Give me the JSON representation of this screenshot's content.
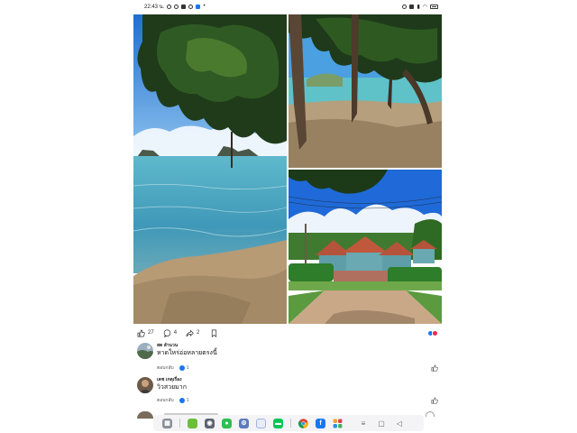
{
  "status_bar": {
    "time": "22:43 น."
  },
  "post": {
    "photos": [
      {
        "name": "sea-with-tree-photo"
      },
      {
        "name": "beach-shade-photo"
      },
      {
        "name": "resort-house-photo"
      }
    ],
    "actions": {
      "like_count": "27",
      "comment_count": "4",
      "share_count": "2"
    }
  },
  "comments": [
    {
      "author": "สด ลำนวน",
      "text": "หาดใหร่อ่อหลายตรงนี้",
      "reply_label": "ตอบกลับ",
      "likes": "1"
    },
    {
      "author": "เดช เกตุเรื่อง",
      "text": "วิวสวยมาก",
      "reply_label": "ตอบกลับ",
      "likes": "1"
    }
  ],
  "colors": {
    "facebook_blue": "#1877f2",
    "love_red": "#f0284a",
    "sea_teal": "#4fb3c9",
    "sky_blue": "#2f7fd0"
  },
  "icons": {
    "like": "thumbs-up-icon",
    "comment": "speech-bubble-icon",
    "share": "share-arrow-icon",
    "bookmark": "bookmark-icon"
  }
}
